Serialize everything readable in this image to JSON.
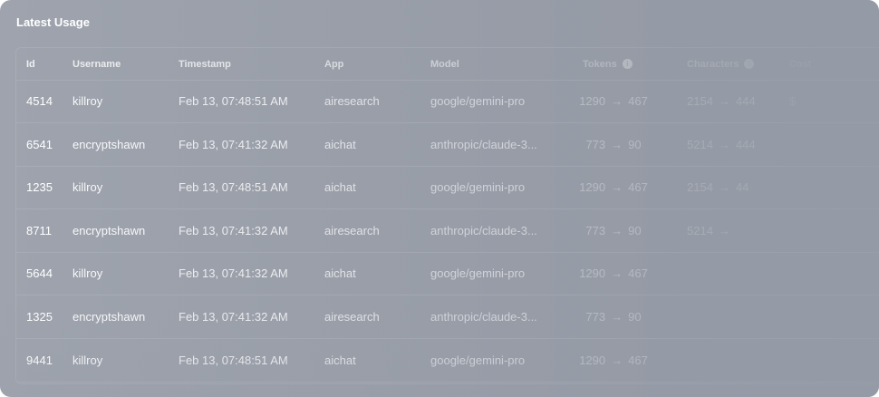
{
  "panel": {
    "title": "Latest Usage"
  },
  "table": {
    "headers": {
      "id": "Id",
      "username": "Username",
      "timestamp": "Timestamp",
      "app": "App",
      "model": "Model",
      "tokens": "Tokens",
      "characters": "Characters",
      "extra": "Cost"
    },
    "rows": [
      {
        "id": "4514",
        "username": "killroy",
        "timestamp": "Feb 13, 07:48:51 AM",
        "app": "airesearch",
        "model": "google/gemini-pro",
        "tokens_in": "1290",
        "tokens_out": "467",
        "chars_in": "2154",
        "chars_out": "444",
        "extra": "$"
      },
      {
        "id": "6541",
        "username": "encryptshawn",
        "timestamp": "Feb 13, 07:41:32 AM",
        "app": "aichat",
        "model": "anthropic/claude-3...",
        "tokens_in": "773",
        "tokens_out": "90",
        "chars_in": "5214",
        "chars_out": "444",
        "extra": ""
      },
      {
        "id": "1235",
        "username": "killroy",
        "timestamp": "Feb 13, 07:48:51 AM",
        "app": "aichat",
        "model": "google/gemini-pro",
        "tokens_in": "1290",
        "tokens_out": "467",
        "chars_in": "2154",
        "chars_out": "44",
        "extra": ""
      },
      {
        "id": "8711",
        "username": "encryptshawn",
        "timestamp": "Feb 13, 07:41:32 AM",
        "app": "airesearch",
        "model": "anthropic/claude-3...",
        "tokens_in": "773",
        "tokens_out": "90",
        "chars_in": "5214",
        "chars_out": "",
        "extra": ""
      },
      {
        "id": "5644",
        "username": "killroy",
        "timestamp": "Feb 13, 07:41:32 AM",
        "app": "aichat",
        "model": "google/gemini-pro",
        "tokens_in": "1290",
        "tokens_out": "467",
        "chars_in": "",
        "chars_out": "",
        "extra": ""
      },
      {
        "id": "1325",
        "username": "encryptshawn",
        "timestamp": "Feb 13, 07:41:32 AM",
        "app": "airesearch",
        "model": "anthropic/claude-3...",
        "tokens_in": "773",
        "tokens_out": "90",
        "chars_in": "",
        "chars_out": "",
        "extra": ""
      },
      {
        "id": "9441",
        "username": "killroy",
        "timestamp": "Feb 13, 07:48:51 AM",
        "app": "aichat",
        "model": "google/gemini-pro",
        "tokens_in": "1290",
        "tokens_out": "467",
        "chars_in": "",
        "chars_out": "",
        "extra": ""
      }
    ],
    "arrow_glyph": "→",
    "info_glyph": "i"
  },
  "colors": {
    "panel_bg": "#9ea3ad",
    "text": "#ffffff"
  }
}
